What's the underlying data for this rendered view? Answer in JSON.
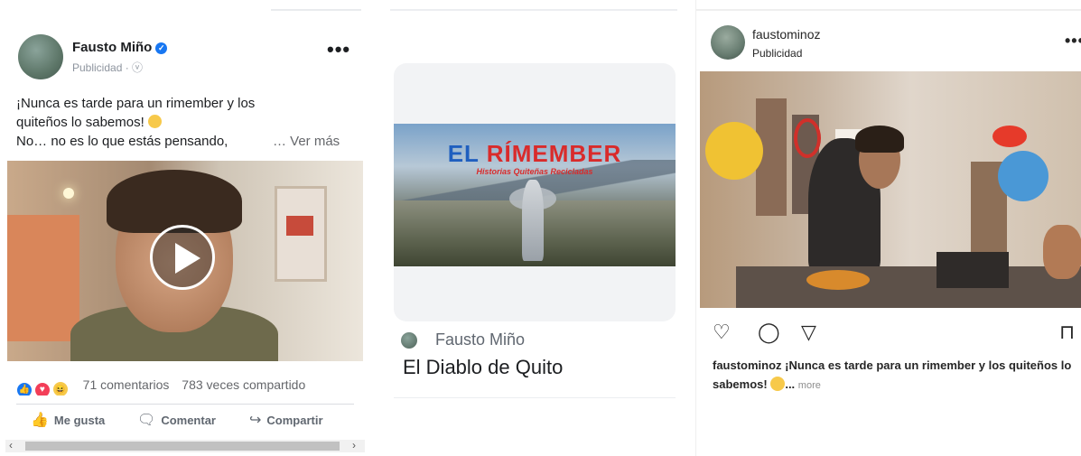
{
  "facebook_post": {
    "author": "Fausto Miño",
    "meta": "Publicidad · ⓥ",
    "text_line1": "¡Nunca es tarde para un rimember y los",
    "text_line2": "quiteños lo sabemos!",
    "text_line3": "No… no es lo que estás pensando,",
    "ver_mas": "… Ver más",
    "comments": "71 comentarios",
    "shares": "783 veces compartido",
    "actions": {
      "like": "Me gusta",
      "comment": "Comentar",
      "share": "Compartir"
    }
  },
  "video_card": {
    "banner_title_a": "EL ",
    "banner_title_b": "RÍMEMBER",
    "banner_subtitle": "Historias Quiteñas Recicladas",
    "author": "Fausto Miño",
    "title": "El Diablo de Quito"
  },
  "instagram_post": {
    "username": "faustominoz",
    "sponsored": "Publicidad",
    "caption_user": "faustominoz",
    "caption_text": " ¡Nunca es tarde para un rimember y los quiteños lo sabemos!",
    "caption_ellipsis": "...",
    "more": "more"
  },
  "colors": {
    "facebook_blue": "#1877f2",
    "text_dark": "#1c1e21",
    "text_muted": "#65676b"
  }
}
